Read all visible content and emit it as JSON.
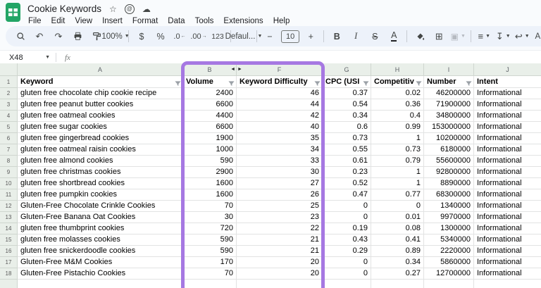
{
  "app": {
    "title": "Cookie Keywords",
    "menu": [
      "File",
      "Edit",
      "View",
      "Insert",
      "Format",
      "Data",
      "Tools",
      "Extensions",
      "Help"
    ]
  },
  "toolbar": {
    "zoom_level": "100%",
    "currency": "$",
    "percent": "%",
    "decrease_decimal": ".0",
    "increase_decimal": ".00",
    "more_formats": "123",
    "font_style": "Defaul...",
    "font_size_decrease": "−",
    "font_size": "10",
    "font_size_increase": "+",
    "bold": "B",
    "italic": "I",
    "strikethrough": "S",
    "text_color": "A",
    "borders": "⊞",
    "align": "≡",
    "vertical_align": "↧",
    "text_wrap": "↩",
    "text_rotation": "A",
    "undo": "↶",
    "redo": "↷"
  },
  "formula_bar": {
    "cell_reference": "X48",
    "fx_label": "fx"
  },
  "sheet": {
    "header_row_number": "1",
    "column_letters": [
      "A",
      "B",
      "F",
      "G",
      "H",
      "I",
      "J"
    ],
    "headers": [
      {
        "label": "Keyword",
        "filter": true
      },
      {
        "label": "Volume",
        "filter": true
      },
      {
        "label": "Keyword Difficulty",
        "filter": true
      },
      {
        "label": "CPC (USI",
        "filter": true
      },
      {
        "label": "Competitiv",
        "filter": true
      },
      {
        "label": "Number",
        "filter": true
      },
      {
        "label": "Intent",
        "filter": false
      }
    ],
    "rows": [
      {
        "n": "2",
        "keyword": "gluten free chocolate chip cookie recipe",
        "volume": "2400",
        "kd": "46",
        "cpc": "0.37",
        "competition": "0.02",
        "number": "46200000",
        "intent": "Informational"
      },
      {
        "n": "3",
        "keyword": "gluten free peanut butter cookies",
        "volume": "6600",
        "kd": "44",
        "cpc": "0.54",
        "competition": "0.36",
        "number": "71900000",
        "intent": "Informational"
      },
      {
        "n": "4",
        "keyword": "gluten free oatmeal cookies",
        "volume": "4400",
        "kd": "42",
        "cpc": "0.34",
        "competition": "0.4",
        "number": "34800000",
        "intent": "Informational"
      },
      {
        "n": "5",
        "keyword": "gluten free sugar cookies",
        "volume": "6600",
        "kd": "40",
        "cpc": "0.6",
        "competition": "0.99",
        "number": "153000000",
        "intent": "Informational"
      },
      {
        "n": "6",
        "keyword": "gluten free gingerbread cookies",
        "volume": "1900",
        "kd": "35",
        "cpc": "0.73",
        "competition": "1",
        "number": "10200000",
        "intent": "Informational"
      },
      {
        "n": "7",
        "keyword": "gluten free oatmeal raisin cookies",
        "volume": "1000",
        "kd": "34",
        "cpc": "0.55",
        "competition": "0.73",
        "number": "6180000",
        "intent": "Informational"
      },
      {
        "n": "8",
        "keyword": "gluten free almond cookies",
        "volume": "590",
        "kd": "33",
        "cpc": "0.61",
        "competition": "0.79",
        "number": "55600000",
        "intent": "Informational"
      },
      {
        "n": "9",
        "keyword": "gluten free christmas cookies",
        "volume": "2900",
        "kd": "30",
        "cpc": "0.23",
        "competition": "1",
        "number": "92800000",
        "intent": "Informational"
      },
      {
        "n": "10",
        "keyword": "gluten free shortbread cookies",
        "volume": "1600",
        "kd": "27",
        "cpc": "0.52",
        "competition": "1",
        "number": "8890000",
        "intent": "Informational"
      },
      {
        "n": "11",
        "keyword": "gluten free pumpkin cookies",
        "volume": "1600",
        "kd": "26",
        "cpc": "0.47",
        "competition": "0.77",
        "number": "68300000",
        "intent": "Informational"
      },
      {
        "n": "12",
        "keyword": "Gluten-Free Chocolate Crinkle Cookies",
        "volume": "70",
        "kd": "25",
        "cpc": "0",
        "competition": "0",
        "number": "1340000",
        "intent": "Informational"
      },
      {
        "n": "13",
        "keyword": "Gluten-Free Banana Oat Cookies",
        "volume": "30",
        "kd": "23",
        "cpc": "0",
        "competition": "0.01",
        "number": "9970000",
        "intent": "Informational"
      },
      {
        "n": "14",
        "keyword": "gluten free thumbprint cookies",
        "volume": "720",
        "kd": "22",
        "cpc": "0.19",
        "competition": "0.08",
        "number": "1300000",
        "intent": "Informational"
      },
      {
        "n": "15",
        "keyword": "gluten free molasses cookies",
        "volume": "590",
        "kd": "21",
        "cpc": "0.43",
        "competition": "0.41",
        "number": "5340000",
        "intent": "Informational"
      },
      {
        "n": "16",
        "keyword": "gluten free snickerdoodle cookies",
        "volume": "590",
        "kd": "21",
        "cpc": "0.29",
        "competition": "0.89",
        "number": "2220000",
        "intent": "Informational"
      },
      {
        "n": "17",
        "keyword": "Gluten-Free M&M Cookies",
        "volume": "170",
        "kd": "20",
        "cpc": "0",
        "competition": "0.34",
        "number": "5860000",
        "intent": "Informational"
      },
      {
        "n": "18",
        "keyword": "Gluten-Free Pistachio Cookies",
        "volume": "70",
        "kd": "20",
        "cpc": "0",
        "competition": "0.27",
        "number": "12700000",
        "intent": "Informational"
      }
    ]
  },
  "annotation": {
    "highlight_color": "#a678e2"
  }
}
